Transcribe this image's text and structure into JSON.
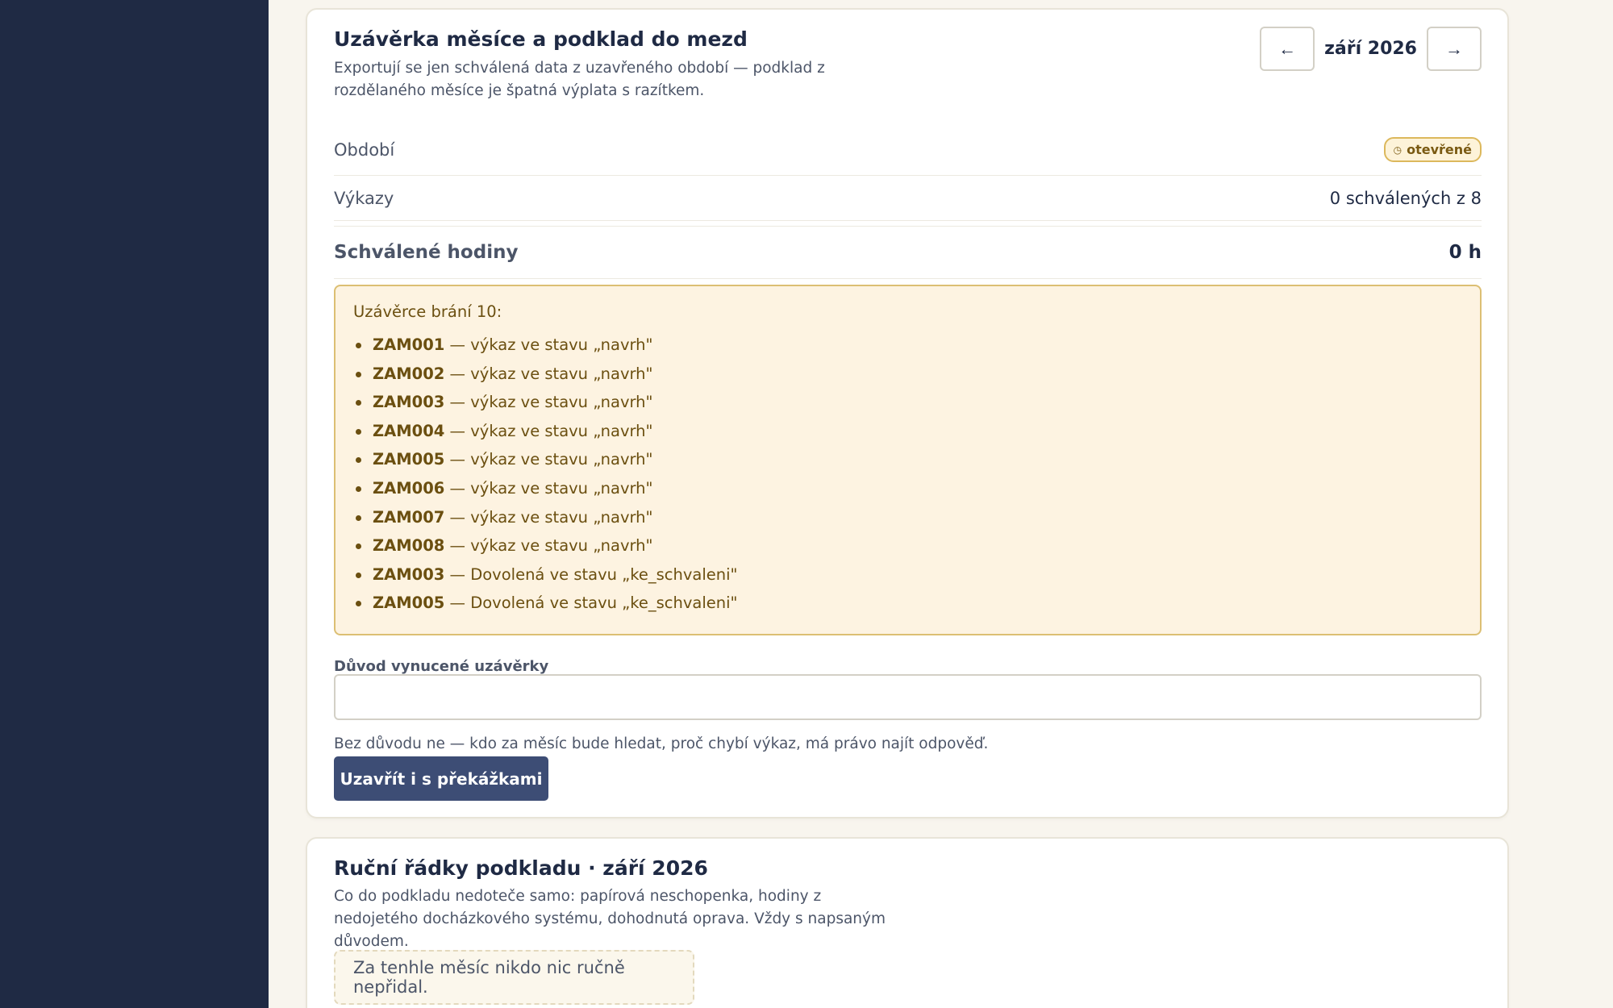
{
  "closing": {
    "title": "Uzávěrka měsíce a podklad do mezd",
    "description": "Exportují se jen schválená data z uzavřeného období — podklad z rozdělaného měsíce je špatná výplata s razítkem.",
    "month_nav": {
      "prev_icon": "←",
      "month": "září 2026",
      "next_icon": "→"
    },
    "rows": {
      "period_label": "Období",
      "period_status": "otevřené",
      "period_status_icon": "◷",
      "reports_label": "Výkazy",
      "reports_value": "0 schválených z 8",
      "hours_label": "Schválené hodiny",
      "hours_value": "0 h"
    },
    "blockers": {
      "title": "Uzávěrce brání 10:",
      "items": [
        {
          "code": "ZAM001",
          "text": " — výkaz ve stavu „navrh\""
        },
        {
          "code": "ZAM002",
          "text": " — výkaz ve stavu „navrh\""
        },
        {
          "code": "ZAM003",
          "text": " — výkaz ve stavu „navrh\""
        },
        {
          "code": "ZAM004",
          "text": " — výkaz ve stavu „navrh\""
        },
        {
          "code": "ZAM005",
          "text": " — výkaz ve stavu „navrh\""
        },
        {
          "code": "ZAM006",
          "text": " — výkaz ve stavu „navrh\""
        },
        {
          "code": "ZAM007",
          "text": " — výkaz ve stavu „navrh\""
        },
        {
          "code": "ZAM008",
          "text": " — výkaz ve stavu „navrh\""
        },
        {
          "code": "ZAM003",
          "text": " — Dovolená ve stavu „ke_schvaleni\""
        },
        {
          "code": "ZAM005",
          "text": " — Dovolená ve stavu „ke_schvaleni\""
        }
      ]
    },
    "reason_field": {
      "label": "Důvod vynucené uzávěrky",
      "value": "",
      "placeholder": "",
      "hint": "Bez důvodu ne — kdo za měsíc bude hledat, proč chybí výkaz, má právo najít odpověď."
    },
    "close_button": "Uzavřít i s překážkami"
  },
  "manual": {
    "title": "Ruční řádky podkladu · září 2026",
    "description": "Co do podkladu nedoteče samo: papírová neschopenka, hodiny z nedojetého docházkového systému, dohodnutá oprava. Vždy s napsaným důvodem.",
    "empty_text": "Za tenhle měsíc nikdo nic ručně nepřidal."
  },
  "colors": {
    "sidebar": "#1f2a44",
    "background": "#f8f5ee",
    "primary": "#3d4d75",
    "warning_bg": "#fdf3e1",
    "warning_border": "#dcbf73"
  }
}
